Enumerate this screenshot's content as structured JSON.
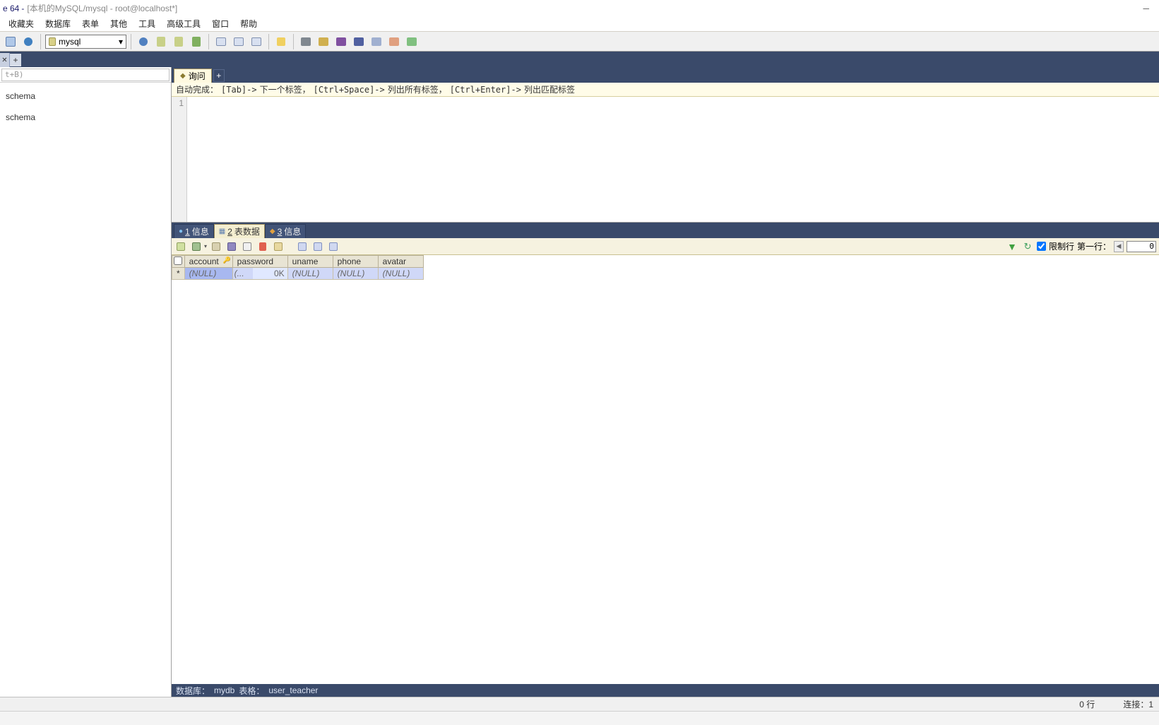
{
  "title": {
    "app": "e 64",
    "path": "[本机的MySQL/mysql - root@localhost*]"
  },
  "menu": {
    "favorites": "收藏夹",
    "database": "数据库",
    "table": "表单",
    "other": "其他",
    "tools": "工具",
    "adv_tools": "高级工具",
    "window": "窗口",
    "help": "帮助"
  },
  "toolbar": {
    "db_select": "mysql"
  },
  "sidebar": {
    "filter_placeholder": "t+B)",
    "items": [
      "schema",
      "schema"
    ]
  },
  "query": {
    "tab_label": "询问",
    "hint": {
      "prefix": "自动完成：",
      "p1a": "[Tab]->",
      "p1b": "下一个标签，",
      "p2a": "[Ctrl+Space]->",
      "p2b": "列出所有标签，",
      "p3a": "[Ctrl+Enter]->",
      "p3b": "列出匹配标签"
    },
    "gutter": "1"
  },
  "result_tabs": {
    "t1_num": "1",
    "t1_label": "信息",
    "t2_num": "2",
    "t2_label": "表数据",
    "t3_num": "3",
    "t3_label": "信息"
  },
  "data_toolbar": {
    "limit_rows": "限制行",
    "first_row": "第一行：",
    "row_value": "0"
  },
  "grid": {
    "columns": [
      "account",
      "password",
      "uname",
      "phone",
      "avatar"
    ],
    "row": {
      "marker": "*",
      "account": "(NULL)",
      "password_prefix": "(...",
      "password_size": "0K",
      "uname": "(NULL)",
      "phone": "(NULL)",
      "avatar": "(NULL)"
    }
  },
  "infobar": {
    "db_label": "数据库：",
    "db_value": "mydb",
    "tbl_label": "表格：",
    "tbl_value": "user_teacher"
  },
  "status": {
    "rows": "0 行",
    "conn": "连接：1"
  }
}
